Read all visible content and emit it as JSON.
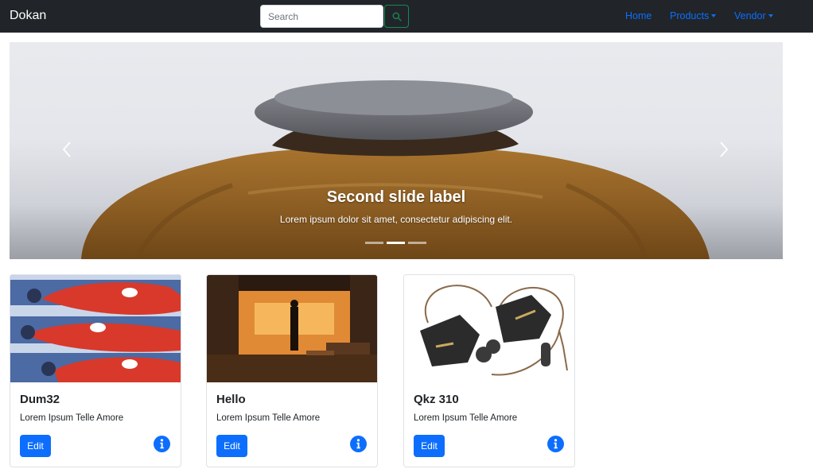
{
  "navbar": {
    "brand": "Dokan",
    "search": {
      "placeholder": "Search",
      "value": "",
      "button_icon": "search-icon"
    },
    "links": [
      {
        "label": "Home",
        "dropdown": false
      },
      {
        "label": "Products",
        "dropdown": true
      },
      {
        "label": "Vendor",
        "dropdown": true
      }
    ],
    "colors": {
      "background": "#212529",
      "link": "#0d6efd",
      "search_button": "#198754"
    }
  },
  "carousel": {
    "caption_title": "Second slide label",
    "caption_text": "Lorem ipsum dolor sit amet, consectetur adipiscing elit.",
    "slide_count": 3,
    "active_slide": 2,
    "prev_icon": "chevron-left-icon",
    "next_icon": "chevron-right-icon"
  },
  "cards": [
    {
      "title": "Dum32",
      "text": "Lorem Ipsum Telle Amore",
      "button_label": "Edit",
      "info_icon": "info-icon"
    },
    {
      "title": "Hello",
      "text": "Lorem Ipsum Telle Amore",
      "button_label": "Edit",
      "info_icon": "info-icon"
    },
    {
      "title": "Qkz 310",
      "text": "Lorem Ipsum Telle Amore",
      "button_label": "Edit",
      "info_icon": "info-icon"
    }
  ],
  "colors": {
    "primary": "#0d6efd",
    "card_border": "#dfe1e5"
  }
}
